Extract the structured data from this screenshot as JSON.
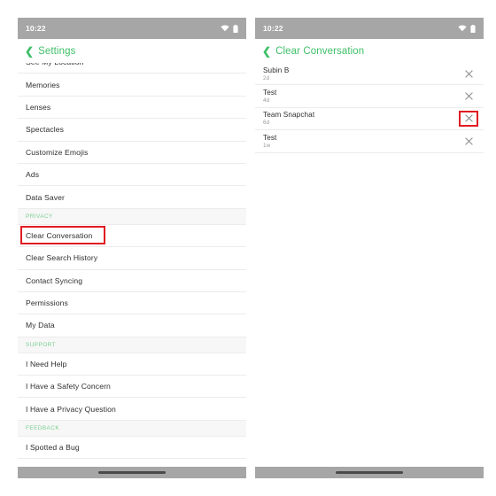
{
  "status_bar": {
    "time": "10:22",
    "wifi_icon": "wifi-icon",
    "battery_icon": "battery-icon"
  },
  "colors": {
    "accent_green": "#3fc069",
    "section_green": "#79cf92",
    "highlight_red": "#e01b22",
    "status_gray": "#a6a6a6",
    "row_text": "#2e2e2e",
    "muted_text": "#9a9a9a",
    "section_bg": "#f7f7f7",
    "divider": "#ececec"
  },
  "left_panel": {
    "header": {
      "back_icon": "chevron-left-icon",
      "title": "Settings"
    },
    "rows": [
      {
        "label": "See My Location",
        "type": "item",
        "clipped": true,
        "highlight": false
      },
      {
        "label": "Memories",
        "type": "item",
        "highlight": false
      },
      {
        "label": "Lenses",
        "type": "item",
        "highlight": false
      },
      {
        "label": "Spectacles",
        "type": "item",
        "highlight": false
      },
      {
        "label": "Customize Emojis",
        "type": "item",
        "highlight": false
      },
      {
        "label": "Ads",
        "type": "item",
        "highlight": false
      },
      {
        "label": "Data Saver",
        "type": "item",
        "highlight": false
      },
      {
        "label": "PRIVACY",
        "type": "section"
      },
      {
        "label": "Clear Conversation",
        "type": "item",
        "highlight": true
      },
      {
        "label": "Clear Search History",
        "type": "item",
        "highlight": false
      },
      {
        "label": "Contact Syncing",
        "type": "item",
        "highlight": false
      },
      {
        "label": "Permissions",
        "type": "item",
        "highlight": false
      },
      {
        "label": "My Data",
        "type": "item",
        "highlight": false
      },
      {
        "label": "SUPPORT",
        "type": "section"
      },
      {
        "label": "I Need Help",
        "type": "item",
        "highlight": false
      },
      {
        "label": "I Have a Safety Concern",
        "type": "item",
        "highlight": false
      },
      {
        "label": "I Have a Privacy Question",
        "type": "item",
        "highlight": false
      },
      {
        "label": "FEEDBACK",
        "type": "section"
      },
      {
        "label": "I Spotted a Bug",
        "type": "item",
        "highlight": false
      }
    ]
  },
  "right_panel": {
    "header": {
      "back_icon": "chevron-left-icon",
      "title": "Clear Conversation"
    },
    "conversations": [
      {
        "name": "Subin B",
        "time": "2d",
        "clear_icon": "close-x-icon",
        "highlight": false
      },
      {
        "name": "Test",
        "time": "4d",
        "clear_icon": "close-x-icon",
        "highlight": false
      },
      {
        "name": "Team Snapchat",
        "time": "6d",
        "clear_icon": "close-x-icon",
        "highlight": true
      },
      {
        "name": "Test",
        "time": "1w",
        "clear_icon": "close-x-icon",
        "highlight": false
      }
    ]
  },
  "home_indicator": "home-indicator-bar"
}
